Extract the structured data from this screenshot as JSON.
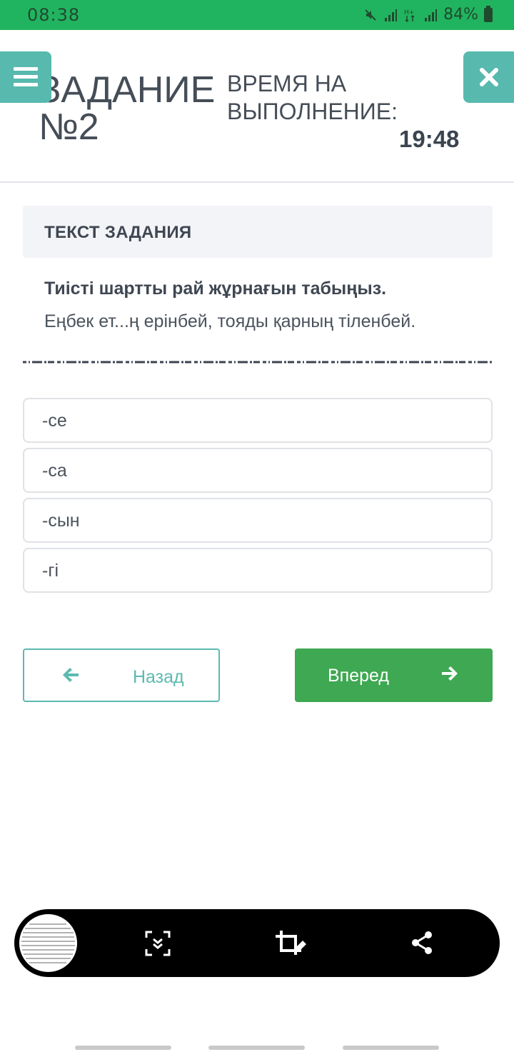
{
  "status_bar": {
    "time": "08:38",
    "battery": "84%"
  },
  "header": {
    "title": "ЗАДАНИЕ №2",
    "timer_label": "ВРЕМЯ НА ВЫПОЛНЕНИЕ:",
    "timer_value": "19:48"
  },
  "task": {
    "box_title": "ТЕКСТ ЗАДАНИЯ",
    "question": "Тиісті шартты рай жұрнағын табыңыз.",
    "sentence": "Еңбек ет...ң ерінбей, тояды қарның тіленбей."
  },
  "answers": [
    "-се",
    "-са",
    "-сын",
    "-гі"
  ],
  "nav": {
    "back_label": "Назад",
    "next_label": "Вперед"
  },
  "colors": {
    "status_green": "#21b460",
    "teal": "#58b9ae",
    "next_green": "#3ea852"
  }
}
